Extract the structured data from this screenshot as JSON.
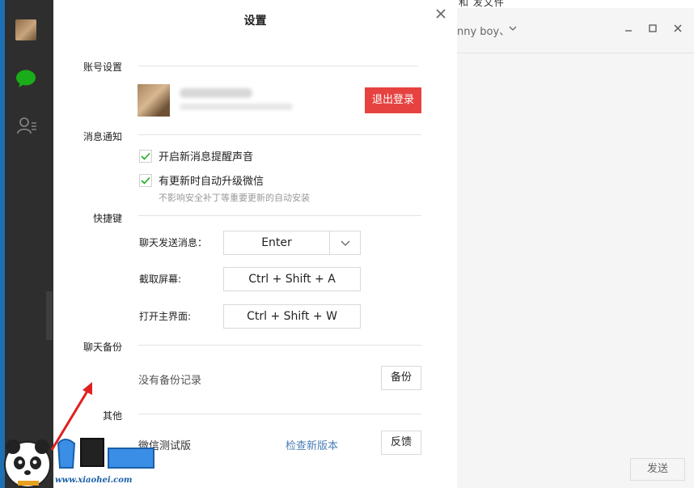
{
  "dialog": {
    "title": "设置"
  },
  "account": {
    "section_label": "账号设置",
    "logout_label": "退出登录"
  },
  "notifications": {
    "section_label": "消息通知",
    "items": [
      {
        "label": "开启新消息提醒声音",
        "checked": true
      },
      {
        "label": "有更新时自动升级微信",
        "checked": true
      }
    ],
    "update_note": "不影响安全补丁等重要更新的自动安装"
  },
  "shortcuts": {
    "section_label": "快捷键",
    "send_label": "聊天发送消息：",
    "send_value": "Enter",
    "screenshot_label": "截取屏幕:",
    "screenshot_value": "Ctrl + Shift + A",
    "open_main_label": "打开主界面:",
    "open_main_value": "Ctrl + Shift + W"
  },
  "backup": {
    "section_label": "聊天备份",
    "status": "没有备份记录",
    "button_label": "备份"
  },
  "other": {
    "section_label": "其他",
    "version_text": "微信测试版",
    "check_update_link": "检查新版本",
    "feedback_label": "反馈"
  },
  "background_window": {
    "top_text": "和 发文件",
    "chat_title": "nny boy、",
    "send_label": "发送"
  },
  "watermark": {
    "url": "www.xiaohei.com"
  },
  "colors": {
    "accent_green": "#1aad19",
    "logout_red": "#e64340",
    "link_blue": "#4a7fb5",
    "sidebar_dark": "#2e2e2e"
  },
  "icons": {
    "sidebar": [
      "chat-icon",
      "contacts-icon"
    ],
    "dialog": [
      "close-icon",
      "check-icon",
      "chevron-down-icon"
    ],
    "window": [
      "minimize-icon",
      "maximize-icon",
      "close-icon"
    ]
  }
}
